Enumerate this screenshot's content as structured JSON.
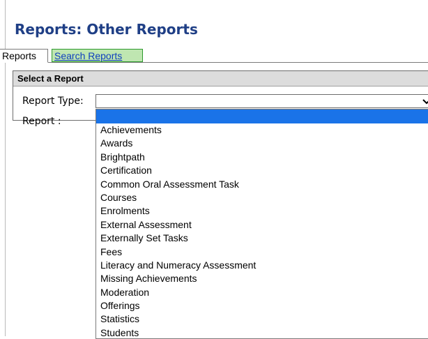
{
  "page": {
    "title": "Reports: Other Reports"
  },
  "tabs": [
    {
      "label": "Reports",
      "active": true
    },
    {
      "label": "Search Reports",
      "active": false
    }
  ],
  "panel": {
    "header": "Select a Report",
    "report_type_label": "Report Type:",
    "report_label": "Report :"
  },
  "report_type_select": {
    "value": "",
    "options": [
      "",
      "Achievements",
      "Awards",
      "Brightpath",
      "Certification",
      "Common Oral Assessment Task",
      "Courses",
      "Enrolments",
      "External Assessment",
      "Externally Set Tasks",
      "Fees",
      "Literacy and Numeracy Assessment",
      "Missing Achievements",
      "Moderation",
      "Offerings",
      "Statistics",
      "Students"
    ]
  },
  "colors": {
    "title": "#1f3f86",
    "tab_search_bg": "#bfe6b1",
    "link": "#0f3fbf",
    "selection": "#1a73e8",
    "panel_header_bg": "#dcdcdc"
  }
}
